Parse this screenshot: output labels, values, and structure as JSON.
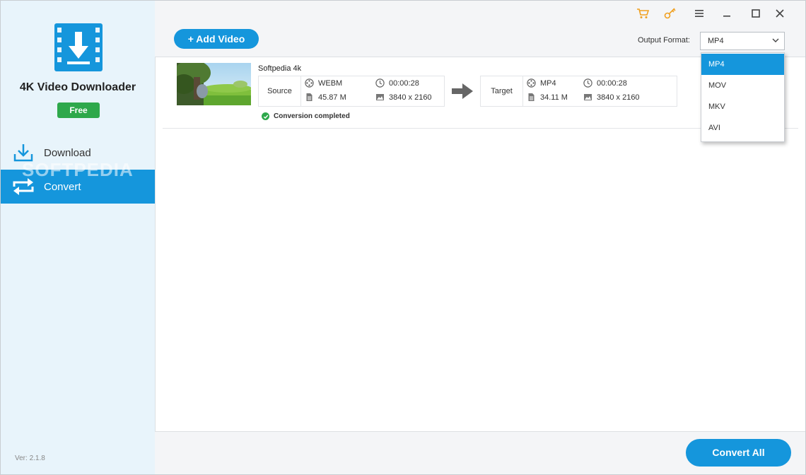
{
  "app": {
    "name": "4K Video Downloader",
    "badge": "Free",
    "version": "Ver: 2.1.8",
    "watermark": "SOFTPEDIA"
  },
  "sidebar": {
    "items": [
      {
        "label": "Download",
        "icon": "download-icon",
        "active": false
      },
      {
        "label": "Convert",
        "icon": "convert-icon",
        "active": true
      }
    ]
  },
  "titlebar": {
    "icons": [
      "cart-icon",
      "key-icon",
      "menu-icon",
      "minimize-icon",
      "maximize-icon",
      "close-icon"
    ]
  },
  "toolbar": {
    "add_video_label": "+ Add Video",
    "output_format_label": "Output Format:",
    "output_format_value": "MP4"
  },
  "format_dropdown": {
    "options": [
      "MP4",
      "MOV",
      "MKV",
      "AVI"
    ],
    "selected": "MP4"
  },
  "video": {
    "title": "Softpedia 4k",
    "source": {
      "label": "Source",
      "format": "WEBM",
      "duration": "00:00:28",
      "size": "45.87 M",
      "resolution": "3840 x 2160"
    },
    "target": {
      "label": "Target",
      "format": "MP4",
      "duration": "00:00:28",
      "size": "34.11 M",
      "resolution": "3840 x 2160"
    },
    "status": "Conversion completed"
  },
  "footer": {
    "convert_all_label": "Convert All"
  },
  "colors": {
    "accent": "#1596dc",
    "success": "#2ea84b",
    "sidebar_bg": "#e8f4fb",
    "titlebar_icon_orange": "#f0a020"
  }
}
